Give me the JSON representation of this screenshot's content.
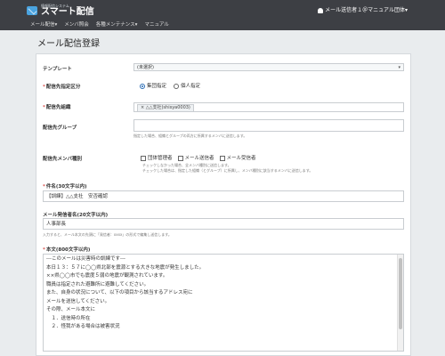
{
  "header": {
    "logo_sub": "情報配信システム",
    "logo_main": "スマート配信",
    "user_label": "メール送信者１＠マニュアル団体▾"
  },
  "nav": [
    "メール配信▾",
    "メンバ照会",
    "各種メンテナンス▾",
    "マニュアル"
  ],
  "page_title": "メール配信登録",
  "form": {
    "template": {
      "label": "テンプレート",
      "value": "(未選択)"
    },
    "target_type": {
      "label": "配信先指定区分",
      "options": [
        "集団指定",
        "個人指定"
      ],
      "selected": 0
    },
    "target_org": {
      "label": "配信先組織",
      "tag": "×  △△支社(shisya0003)"
    },
    "target_group": {
      "label": "配信先グループ",
      "help": "指定した場合、組織とグループの両方に所属するメンバに送信します。"
    },
    "member_type": {
      "label": "配信先メンバ種別",
      "options": [
        "団体管理者",
        "メール送信者",
        "メール受信者"
      ],
      "help1": "チェックしなかった場合、全メンバ種別に送信します。",
      "help2": "チェックした場合は、指定した組織（とグループ）に所属し、メンバ種別に該当するメンバに送信します。"
    },
    "subject": {
      "label": "件名(30文字以内)",
      "value": "【訓練】△△支社　安否確認"
    },
    "sender": {
      "label": "メール発信者名(20文字以内)",
      "value": "人事部長",
      "help": "入力すると、メール本文の先頭に「発信者：xxxx」の形式で編集し送信します。"
    },
    "body": {
      "label": "本文(800文字以内)",
      "lines": [
        "---このメールは災害時の訓練です---",
        "",
        "本日１３：５７に◯◯県北部を震源とする大きな地震が発生しました。",
        "××県◯◯市でも震度５弱の地震が観測されています。",
        "職員は指定された避難所に避難してください。",
        "",
        "また、自身の状況について、以下の項目から該当するアドレス宛に",
        "メールを送信してください。",
        "その際、メール本文に",
        "　１．送信時の所在",
        "　２．怪我がある場合は被害状況"
      ]
    }
  }
}
